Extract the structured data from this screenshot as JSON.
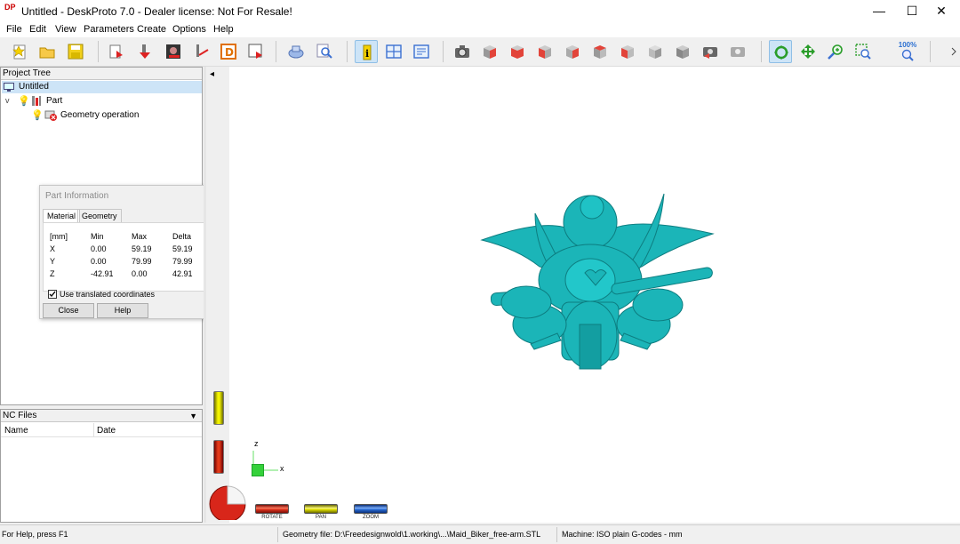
{
  "window": {
    "app_icon_text": "DP",
    "title": "Untitled - DeskProto 7.0 - Dealer license: Not For Resale!",
    "minimize_glyph": "—",
    "maximize_glyph": "☐",
    "close_glyph": "✕"
  },
  "menu": [
    "File",
    "Edit",
    "View",
    "Parameters",
    "Create",
    "Options",
    "Help"
  ],
  "toolbar": {
    "zoom_label": "100%",
    "buttons": [
      "new-project-icon",
      "open-folder-icon",
      "save-icon",
      "import-part-icon",
      "load-part-icon",
      "part-parameters-icon",
      "tool-icon",
      "drawing-icon",
      "save-cnc-icon",
      "part-info-icon",
      "search-icon",
      "info-icon",
      "layout-icon",
      "report-icon",
      "camera-icon",
      "view-cube-front-icon",
      "view-cube-red-icon",
      "view-cube-left-icon",
      "view-cube-right-icon",
      "view-cube-top-icon",
      "view-cube-back-icon",
      "view-cube-gray-icon",
      "view-cube-iso-icon",
      "view-undo-icon",
      "view-settings-icon",
      "rotate-mode-icon",
      "pan-mode-icon",
      "zoom-mode-icon",
      "zoom-window-icon",
      "zoom-fit-icon"
    ]
  },
  "project_tree": {
    "header": "Project Tree",
    "root": "Untitled",
    "part": "Part",
    "operation": "Geometry operation",
    "expander": "v"
  },
  "part_info": {
    "title": "Part Information",
    "tabs": [
      "Material",
      "Geometry"
    ],
    "columns": [
      "[mm]",
      "Min",
      "Max",
      "Delta"
    ],
    "rows": [
      [
        "X",
        "0.00",
        "59.19",
        "59.19"
      ],
      [
        "Y",
        "0.00",
        "79.99",
        "79.99"
      ],
      [
        "Z",
        "-42.91",
        "0.00",
        "42.91"
      ]
    ],
    "checkbox_label": "Use translated coordinates",
    "checkbox_checked": true,
    "close_button": "Close",
    "help_button": "Help",
    "more_glyph": "▼"
  },
  "nc_files": {
    "header": "NC Files",
    "dropdown_glyph": "▼",
    "columns": [
      "Name",
      "Date"
    ]
  },
  "viewport": {
    "collapse_glyph": "◂",
    "model_color": "#1bb5b8",
    "axis_z": "z",
    "axis_x": "x",
    "gauges": [
      "ROTATE",
      "PAN",
      "ZOOM"
    ]
  },
  "status": {
    "help": "For Help, press F1",
    "geometry_file": "Geometry file: D:\\Freedesignwold\\1.working\\...\\Maid_Biker_free-arm.STL",
    "machine": "Machine: ISO plain G-codes - mm"
  }
}
